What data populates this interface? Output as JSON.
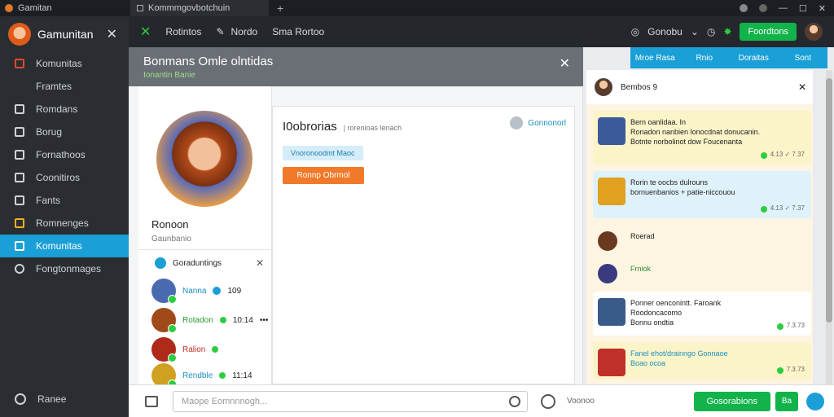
{
  "titlebar": {
    "app": "Gamitan",
    "tab": "Kommmgovbotchuin"
  },
  "header": {
    "items": [
      "Rotintos",
      "Nordo",
      "Sma Rortoo"
    ],
    "account": "Gonobu",
    "action": "Foordtons"
  },
  "sidebar": {
    "brand": "Gamunitan",
    "items": [
      {
        "label": "Komunitas"
      },
      {
        "label": "Framtes"
      },
      {
        "label": "Romdans"
      },
      {
        "label": "Borug"
      },
      {
        "label": "Fornathoos"
      },
      {
        "label": "Coonitiros"
      },
      {
        "label": "Fants"
      },
      {
        "label": "Romnenges"
      },
      {
        "label": "Komunitas",
        "active": true
      },
      {
        "label": "Fongtonmages"
      }
    ],
    "footer": "Ranee"
  },
  "panel": {
    "title": "Bonmans Omle olntidas",
    "subtitle": "Ionantin Banie"
  },
  "profile": {
    "name": "Ronoon",
    "sub": "Gaunbanio",
    "contacts_title": "Goraduntings"
  },
  "contacts": [
    {
      "name": "Nanna",
      "meta": "109"
    },
    {
      "name": "Rotadon",
      "meta": "10:14"
    },
    {
      "name": "Ralion",
      "meta": ""
    },
    {
      "name": "Rendble",
      "meta": "11:14"
    }
  ],
  "editor": {
    "title": "I0obrorias",
    "title_sub": "| rorenioas lenach",
    "connect": "Gonnonorl",
    "chip": "Vnoronoodmt Maoc",
    "button": "Ronnp Obrmol"
  },
  "rtabs": [
    "Mroe Rasa",
    "Rnio",
    "Doraitas",
    "Sont"
  ],
  "chat": {
    "header": "Bembos 9",
    "messages": [
      {
        "text": "Bern oanlidaa. In\nRonadon nanbien lonocdnat donucanin.\nBotnte norbolinot dow Foucenanta",
        "time": "4.13 ✓ 7.37",
        "bg": "#fbf4c8"
      },
      {
        "text": "Rorin te oocbs dulrouns\nbornuenbanios + patie-niccouou",
        "time": "4.13 ✓ 7.37",
        "bg": "#dff2fb"
      },
      {
        "text": "Roerad",
        "time": "",
        "bg": "transparent"
      },
      {
        "text": "Frniok",
        "time": "",
        "bg": "transparent"
      },
      {
        "text": "Ponner oenconintt. Faroank\nRoodoncacomo\nBonnu ondtia",
        "time": "7.3.73",
        "bg": "#ffffff"
      },
      {
        "text": "Fanel ehot/drainngo Gonnaoe\nBoao ocoa",
        "time": "7.3.73",
        "bg": "#fbf4c8"
      }
    ]
  },
  "composer": {
    "placeholder": "Maope Eomnnnogh...",
    "label": "Voonoo",
    "send": "Gosorabions",
    "send2": "Ba"
  }
}
